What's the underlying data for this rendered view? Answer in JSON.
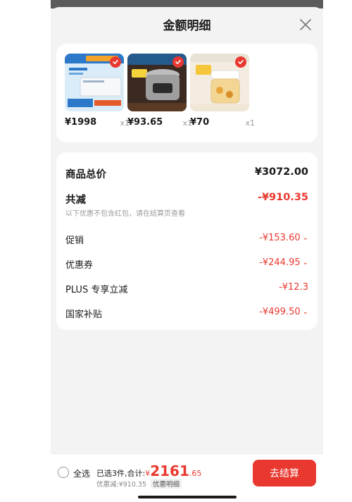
{
  "sheet": {
    "title": "金额明细"
  },
  "products": [
    {
      "price": "¥1998",
      "qty": "x1"
    },
    {
      "price": "¥93.65",
      "qty": "x1"
    },
    {
      "price": "¥70",
      "qty": "x1"
    }
  ],
  "details": {
    "total": {
      "label": "商品总价",
      "value": "¥3072.00"
    },
    "reduce": {
      "label": "共减",
      "value": "-¥910.35",
      "note": "以下优惠不包含红包，请在结算页查看"
    },
    "items": [
      {
        "label": "促销",
        "value": "-¥153.60"
      },
      {
        "label": "优惠券",
        "value": "-¥244.95"
      },
      {
        "label": "PLUS 专享立减",
        "value": "-¥12.3"
      },
      {
        "label": "国家补贴",
        "value": "-¥499.50"
      }
    ]
  },
  "bottom": {
    "select_all": "全选",
    "summary_prefix": "已选3件,合计:",
    "currency": "¥",
    "total_int": "2161",
    "total_dec": ".65",
    "discount": "优惠减:¥910.35",
    "detail_tag": "优惠明细",
    "checkout": "去结算"
  },
  "colors": {
    "accent": "#e8382f",
    "card": "#ffffff",
    "sheet_bg": "#f3f3f3"
  }
}
